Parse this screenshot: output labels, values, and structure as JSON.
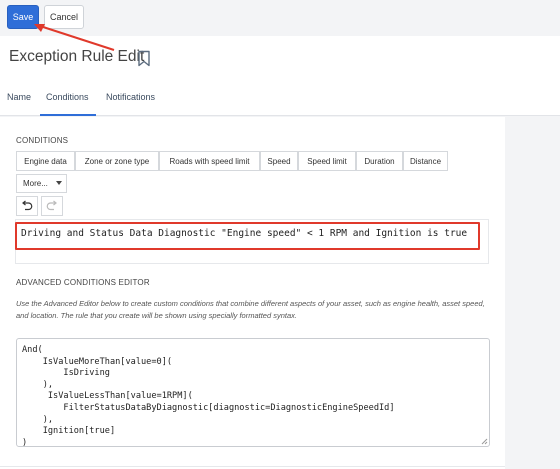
{
  "toolbar": {
    "save_label": "Save",
    "cancel_label": "Cancel"
  },
  "header": {
    "title": "Exception Rule Edit"
  },
  "tabs": [
    {
      "label": "Name"
    },
    {
      "label": "Conditions",
      "active": true
    },
    {
      "label": "Notifications"
    }
  ],
  "conditions": {
    "section_label": "CONDITIONS",
    "buttons": [
      "Engine data",
      "Zone or zone type",
      "Roads with speed limit",
      "Speed",
      "Speed limit",
      "Duration",
      "Distance"
    ],
    "more_label": "More...",
    "condition_text": "Driving and Status Data Diagnostic \"Engine speed\" < 1 RPM and Ignition is true"
  },
  "advanced": {
    "section_label": "ADVANCED CONDITIONS EDITOR",
    "description": "Use the Advanced Editor below to create custom conditions that combine different aspects of your asset, such as engine health, asset speed, and location. The rule that you create will be shown using specially formatted syntax.",
    "code_lines": [
      "And(",
      "    IsValueMoreThan[value=0](",
      "        IsDriving",
      "    ),",
      "     IsValueLessThan[value=1RPM](",
      "        FilterStatusDataByDiagnostic[diagnostic=DiagnosticEngineSpeedId]",
      "    ),",
      "    Ignition[true]",
      ")"
    ]
  },
  "colors": {
    "accent": "#2f6ed8",
    "highlight": "#e0392b"
  },
  "icons": [
    "bookmark-icon",
    "undo-icon",
    "redo-icon",
    "caret-down-icon"
  ]
}
